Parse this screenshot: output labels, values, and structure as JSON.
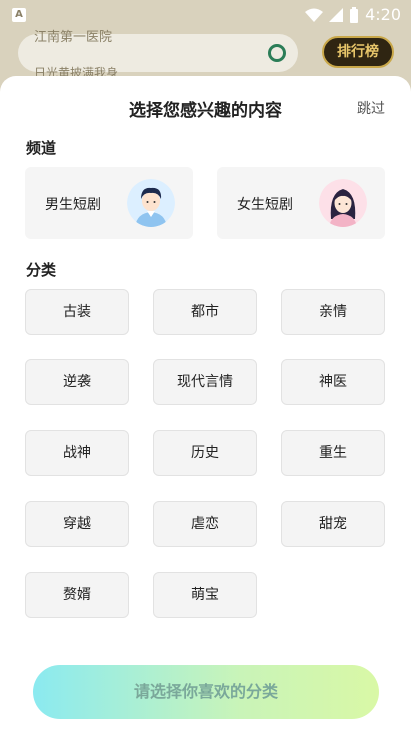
{
  "status_bar": {
    "app_icon_letter": "A",
    "time": "4:20"
  },
  "background": {
    "search_text": "江南第一医院",
    "search_hint": "日光黄披满我身",
    "rank_label": "排行榜"
  },
  "sheet": {
    "title": "选择您感兴趣的内容",
    "skip_label": "跳过",
    "channel_section_label": "频道",
    "channels": [
      {
        "label": "男生短剧",
        "avatar": "male-avatar-icon"
      },
      {
        "label": "女生短剧",
        "avatar": "female-avatar-icon"
      }
    ],
    "category_section_label": "分类",
    "categories": [
      "古装",
      "都市",
      "亲情",
      "逆袭",
      "现代言情",
      "神医",
      "战神",
      "历史",
      "重生",
      "穿越",
      "虐恋",
      "甜宠",
      "赘婿",
      "萌宝"
    ],
    "cta_label": "请选择你喜欢的分类"
  },
  "colors": {
    "cta_start": "#8beaf0",
    "cta_end": "#d9f8a6",
    "cta_text": "#7aa89a"
  }
}
